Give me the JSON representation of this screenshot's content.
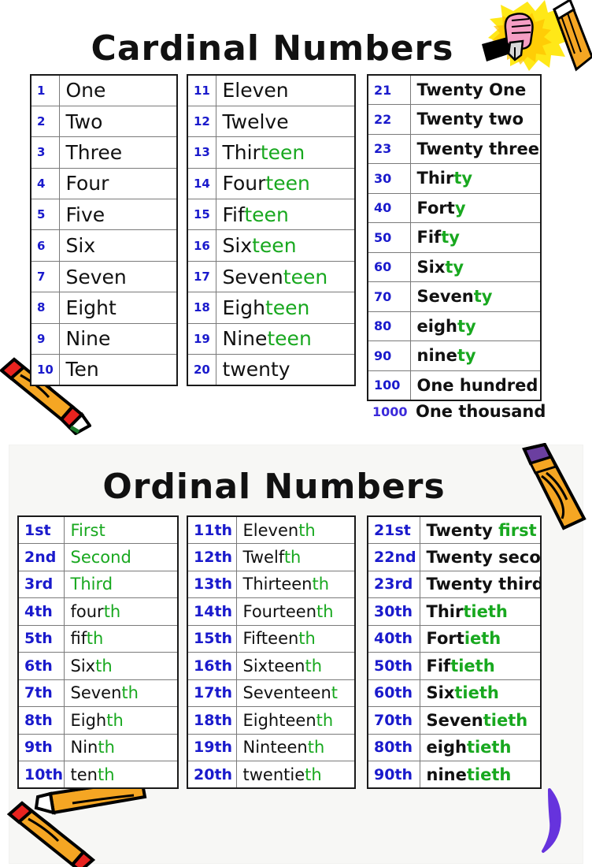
{
  "poster": {
    "cardinal_title": "Cardinal Numbers",
    "ordinal_title": "Ordinal Numbers",
    "colors": {
      "number_blue": "#1a1acc",
      "suffix_green": "#18a81f",
      "word_black": "#111111",
      "table_border": "#1a1a1a",
      "cell_border": "#7a7a7a",
      "ordinal_panel_bg": "#f7f7f5",
      "page_bg": "#ffffff",
      "swirl_purple": "#6633dd",
      "crayon_orange": "#f5a623",
      "crayon_red": "#e8231f",
      "burst_yellow": "#ffe818",
      "fist_pink": "#f59ec4",
      "eraser_purple": "#6b3fa0"
    }
  },
  "cardinal": {
    "column1": [
      {
        "num": "1",
        "stem": "One",
        "suffix": ""
      },
      {
        "num": "2",
        "stem": "Two",
        "suffix": ""
      },
      {
        "num": "3",
        "stem": "Three",
        "suffix": ""
      },
      {
        "num": "4",
        "stem": "Four",
        "suffix": ""
      },
      {
        "num": "5",
        "stem": "Five",
        "suffix": ""
      },
      {
        "num": "6",
        "stem": "Six",
        "suffix": ""
      },
      {
        "num": "7",
        "stem": "Seven",
        "suffix": ""
      },
      {
        "num": "8",
        "stem": "Eight",
        "suffix": ""
      },
      {
        "num": "9",
        "stem": "Nine",
        "suffix": ""
      },
      {
        "num": "10",
        "stem": "Ten",
        "suffix": ""
      }
    ],
    "column2": [
      {
        "num": "11",
        "stem": "Eleven",
        "suffix": ""
      },
      {
        "num": "12",
        "stem": "Twelve",
        "suffix": ""
      },
      {
        "num": "13",
        "stem": "Thir",
        "suffix": "teen"
      },
      {
        "num": "14",
        "stem": "Four",
        "suffix": "teen"
      },
      {
        "num": "15",
        "stem": "Fif",
        "suffix": "teen"
      },
      {
        "num": "16",
        "stem": "Six",
        "suffix": "teen"
      },
      {
        "num": "17",
        "stem": "Seven",
        "suffix": "teen"
      },
      {
        "num": "18",
        "stem": "Eigh",
        "suffix": "teen"
      },
      {
        "num": "19",
        "stem": "Nine",
        "suffix": "teen"
      },
      {
        "num": "20",
        "stem": "twenty",
        "suffix": ""
      }
    ],
    "column3": [
      {
        "num": "21",
        "stem": "Twenty One",
        "suffix": ""
      },
      {
        "num": "22",
        "stem": "Twenty two",
        "suffix": ""
      },
      {
        "num": "23",
        "stem": "Twenty three",
        "suffix": ""
      },
      {
        "num": "30",
        "stem": "Thir",
        "suffix": "ty"
      },
      {
        "num": "40",
        "stem": "Fort",
        "suffix": "y"
      },
      {
        "num": "50",
        "stem": "Fif",
        "suffix": "ty"
      },
      {
        "num": "60",
        "stem": "Six",
        "suffix": "ty"
      },
      {
        "num": "70",
        "stem": "Seven",
        "suffix": "ty"
      },
      {
        "num": "80",
        "stem": "eigh",
        "suffix": "ty"
      },
      {
        "num": "90",
        "stem": "nine",
        "suffix": "ty"
      },
      {
        "num": "100",
        "stem": "One hundred",
        "suffix": ""
      }
    ],
    "extra_row": {
      "num": "1000",
      "stem": "One thousand",
      "suffix": ""
    }
  },
  "ordinal": {
    "column1": [
      {
        "num": "1st",
        "stem": "First",
        "suffix": "",
        "all_green": true
      },
      {
        "num": "2nd",
        "stem": "Second",
        "suffix": "",
        "all_green": true
      },
      {
        "num": "3rd",
        "stem": "Third",
        "suffix": "",
        "all_green": true
      },
      {
        "num": "4th",
        "stem": "four",
        "suffix": "th"
      },
      {
        "num": "5th",
        "stem": "fif",
        "suffix": "th"
      },
      {
        "num": "6th",
        "stem": "Six",
        "suffix": "th"
      },
      {
        "num": "7th",
        "stem": "Seven",
        "suffix": "th"
      },
      {
        "num": "8th",
        "stem": "Eigh",
        "suffix": "th"
      },
      {
        "num": "9th",
        "stem": "Nin",
        "suffix": "th"
      },
      {
        "num": "10th",
        "stem": "ten",
        "suffix": "th"
      }
    ],
    "column2": [
      {
        "num": "11th",
        "stem": "Eleven",
        "suffix": "th"
      },
      {
        "num": "12th",
        "stem": "Twelf",
        "suffix": "th"
      },
      {
        "num": "13th",
        "stem": "Thirteen",
        "suffix": "th"
      },
      {
        "num": "14th",
        "stem": "Fourteen",
        "suffix": "th"
      },
      {
        "num": "15th",
        "stem": "Fifteen",
        "suffix": "th"
      },
      {
        "num": "16th",
        "stem": "Sixteen",
        "suffix": "th"
      },
      {
        "num": "17th",
        "stem": "Seventeen",
        "suffix": "t"
      },
      {
        "num": "18th",
        "stem": "Eighteen",
        "suffix": "th"
      },
      {
        "num": "19th",
        "stem": "Ninteen",
        "suffix": "th"
      },
      {
        "num": "20th",
        "stem": "twentie",
        "suffix": "th"
      }
    ],
    "column3": [
      {
        "num": "21st",
        "stem": "Twenty ",
        "suffix": "first",
        "suffix_green": true
      },
      {
        "num": "22nd",
        "stem": "Twenty second",
        "suffix": ""
      },
      {
        "num": "23rd",
        "stem": "Twenty third",
        "suffix": ""
      },
      {
        "num": "30th",
        "stem": "Thir",
        "suffix": "tieth"
      },
      {
        "num": "40th",
        "stem": "Fort",
        "suffix": "ieth"
      },
      {
        "num": "50th",
        "stem": "Fif",
        "suffix": "tieth"
      },
      {
        "num": "60th",
        "stem": "Six",
        "suffix": "tieth"
      },
      {
        "num": "70th",
        "stem": "Seven",
        "suffix": "tieth"
      },
      {
        "num": "80th",
        "stem": "eigh",
        "suffix": "tieth"
      },
      {
        "num": "90th",
        "stem": "nine",
        "suffix": "tieth"
      }
    ]
  },
  "decorations": [
    {
      "name": "hand-holding-pen-burst-icon",
      "position": "top-right"
    },
    {
      "name": "pencil-icon",
      "position": "top-right"
    },
    {
      "name": "purple-swirl-icon",
      "position": "right-cardinal"
    },
    {
      "name": "crayon-icon",
      "position": "bottom-left-cardinal"
    },
    {
      "name": "pencil-purple-eraser-icon",
      "position": "top-right-ordinal"
    },
    {
      "name": "crossed-crayons-icon",
      "position": "bottom-left-ordinal"
    },
    {
      "name": "purple-swirl-icon",
      "position": "bottom-right-ordinal"
    }
  ]
}
